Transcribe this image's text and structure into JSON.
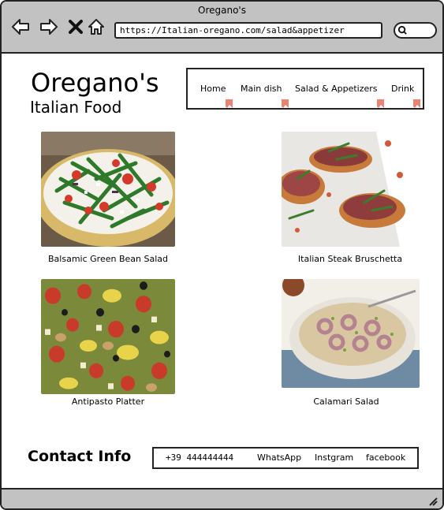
{
  "window": {
    "title": "Oregano's"
  },
  "browser": {
    "url": "https://Italian-oregano.com/salad&appetizer",
    "back_icon": "arrow-left-icon",
    "forward_icon": "arrow-right-icon",
    "close_icon": "close-icon",
    "home_icon": "home-icon",
    "search_icon": "search-icon"
  },
  "header": {
    "brand": "Oregano's",
    "tagline": "Italian Food"
  },
  "nav": {
    "items": [
      {
        "label": "Home"
      },
      {
        "label": "Main dish"
      },
      {
        "label": "Salad & Appetizers"
      },
      {
        "label": "Drink"
      }
    ],
    "marker_color": "#e8846f"
  },
  "dishes": [
    {
      "caption": "Balsamic Green Bean Salad"
    },
    {
      "caption": "Italian Steak Bruschetta"
    },
    {
      "caption": "Antipasto Platter"
    },
    {
      "caption": "Calamari Salad"
    }
  ],
  "contact": {
    "title": "Contact Info",
    "phone": "+39 444444444",
    "whatsapp": "WhatsApp",
    "instagram": "Instgram",
    "facebook": "facebook"
  },
  "colors": {
    "chrome": "#c2c2c2",
    "border": "#222222"
  }
}
